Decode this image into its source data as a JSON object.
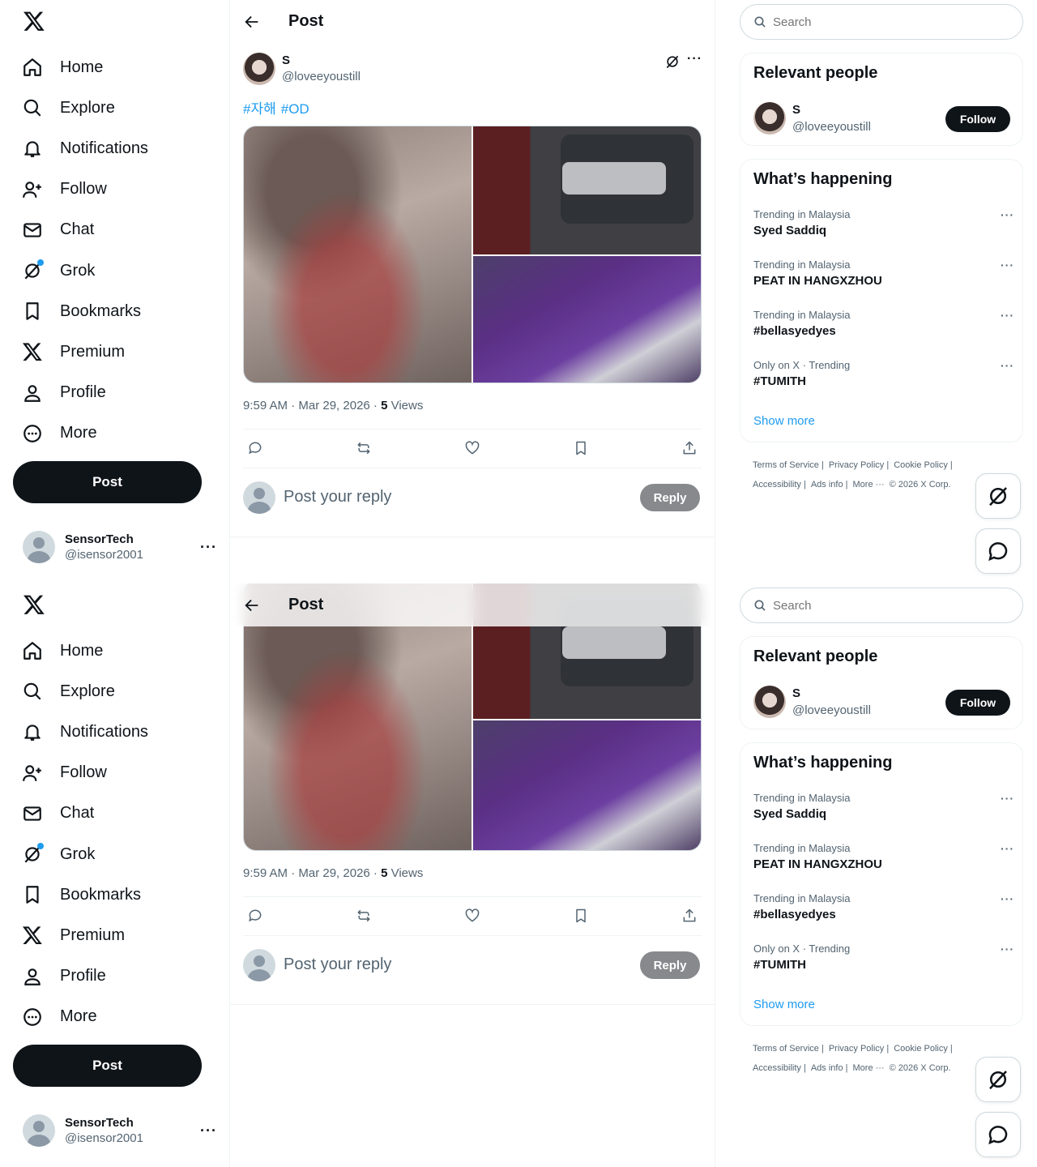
{
  "nav": {
    "items": [
      {
        "label": "Home",
        "icon": "home-icon"
      },
      {
        "label": "Explore",
        "icon": "search-icon"
      },
      {
        "label": "Notifications",
        "icon": "bell-icon"
      },
      {
        "label": "Follow",
        "icon": "person-add-icon"
      },
      {
        "label": "Chat",
        "icon": "mail-icon"
      },
      {
        "label": "Grok",
        "icon": "grok-icon"
      },
      {
        "label": "Bookmarks",
        "icon": "bookmark-icon"
      },
      {
        "label": "Premium",
        "icon": "x-logo-icon"
      },
      {
        "label": "Profile",
        "icon": "person-icon"
      },
      {
        "label": "More",
        "icon": "more-circle-icon"
      }
    ],
    "post_label": "Post"
  },
  "account": {
    "name": "SensorTech",
    "handle": "@isensor2001",
    "more": "···"
  },
  "header": {
    "title": "Post"
  },
  "post": {
    "author_name": "S",
    "author_handle": "@loveeyoustill",
    "hashtags": [
      "#자해",
      "#OD"
    ],
    "time": "9:59 AM · Mar 29, 2026 · ",
    "views_count": "5",
    "views_label": " Views",
    "more": "···"
  },
  "reply": {
    "placeholder": "Post your reply",
    "button": "Reply"
  },
  "search": {
    "placeholder": "Search"
  },
  "relevant": {
    "title": "Relevant people",
    "name": "S",
    "handle": "@loveeyoustill",
    "follow": "Follow"
  },
  "happening": {
    "title": "What’s happening",
    "trends": [
      {
        "context": "Trending in Malaysia",
        "name": "Syed Saddiq"
      },
      {
        "context": "Trending in Malaysia",
        "name": "PEAT IN HANGXZHOU"
      },
      {
        "context": "Trending in Malaysia",
        "name": "#bellasyedyes"
      },
      {
        "context": "Only on X · Trending",
        "name": "#TUMITH"
      }
    ],
    "trend_more": "···",
    "show_more": "Show more"
  },
  "footer": {
    "row1": [
      "Terms of Service |",
      "Privacy Policy |",
      "Cookie Policy |"
    ],
    "row2": [
      "Accessibility |",
      "Ads info |",
      "More ···",
      "© 2026 X Corp."
    ]
  },
  "colors": {
    "accent": "#1d9bf0",
    "text": "#0f1419",
    "muted": "#536471",
    "button_dark": "#0f1419",
    "reply_disabled": "#87898c"
  }
}
